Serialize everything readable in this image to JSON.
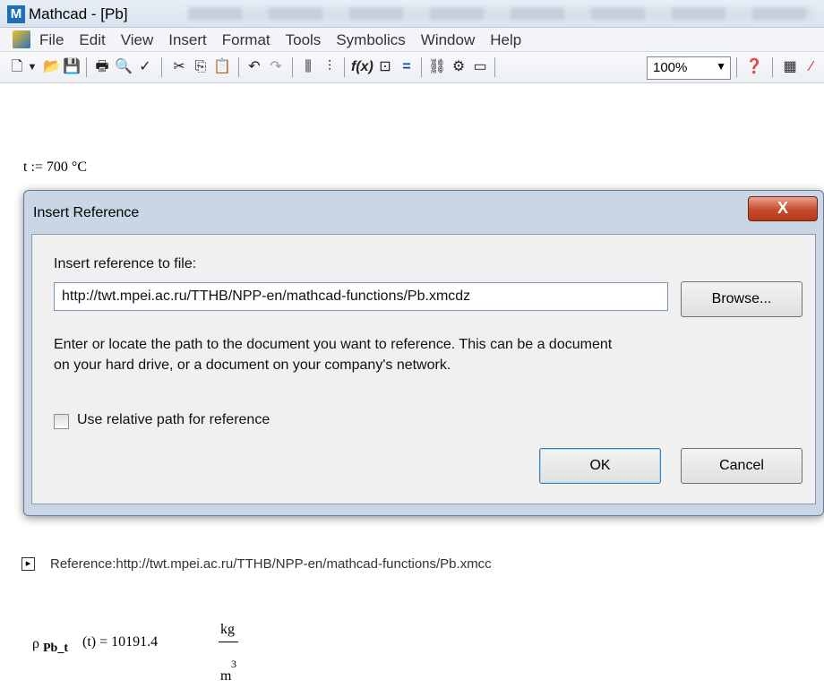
{
  "window": {
    "app_icon_letter": "M",
    "title": "Mathcad - [Pb]"
  },
  "menu": {
    "items": [
      "File",
      "Edit",
      "View",
      "Insert",
      "Format",
      "Tools",
      "Symbolics",
      "Window",
      "Help"
    ]
  },
  "toolbar": {
    "zoom": "100%"
  },
  "worksheet": {
    "assignment": "t := 700 °C",
    "reference_text": "Reference:http://twt.mpei.ac.ru/TTHB/NPP-en/mathcad-functions/Pb.xmcc",
    "rho_lhs_symbol": "ρ",
    "rho_lhs_subscript": "Pb_t",
    "rho_lhs_arg": "(t) = 10191.4",
    "unit_numerator": "kg",
    "unit_denominator": "m",
    "unit_exponent": "3"
  },
  "dialog": {
    "title": "Insert Reference",
    "close_label": "X",
    "prompt": "Insert reference to file:",
    "path_value": "http://twt.mpei.ac.ru/TTHB/NPP-en/mathcad-functions/Pb.xmcdz",
    "browse_label": "Browse...",
    "help_line1": "Enter or locate the path to the document you want to reference. This can be a document",
    "help_line2": "on your hard drive, or a document on your company's network.",
    "relative_label": "Use relative path for reference",
    "relative_checked": false,
    "ok_label": "OK",
    "cancel_label": "Cancel"
  }
}
